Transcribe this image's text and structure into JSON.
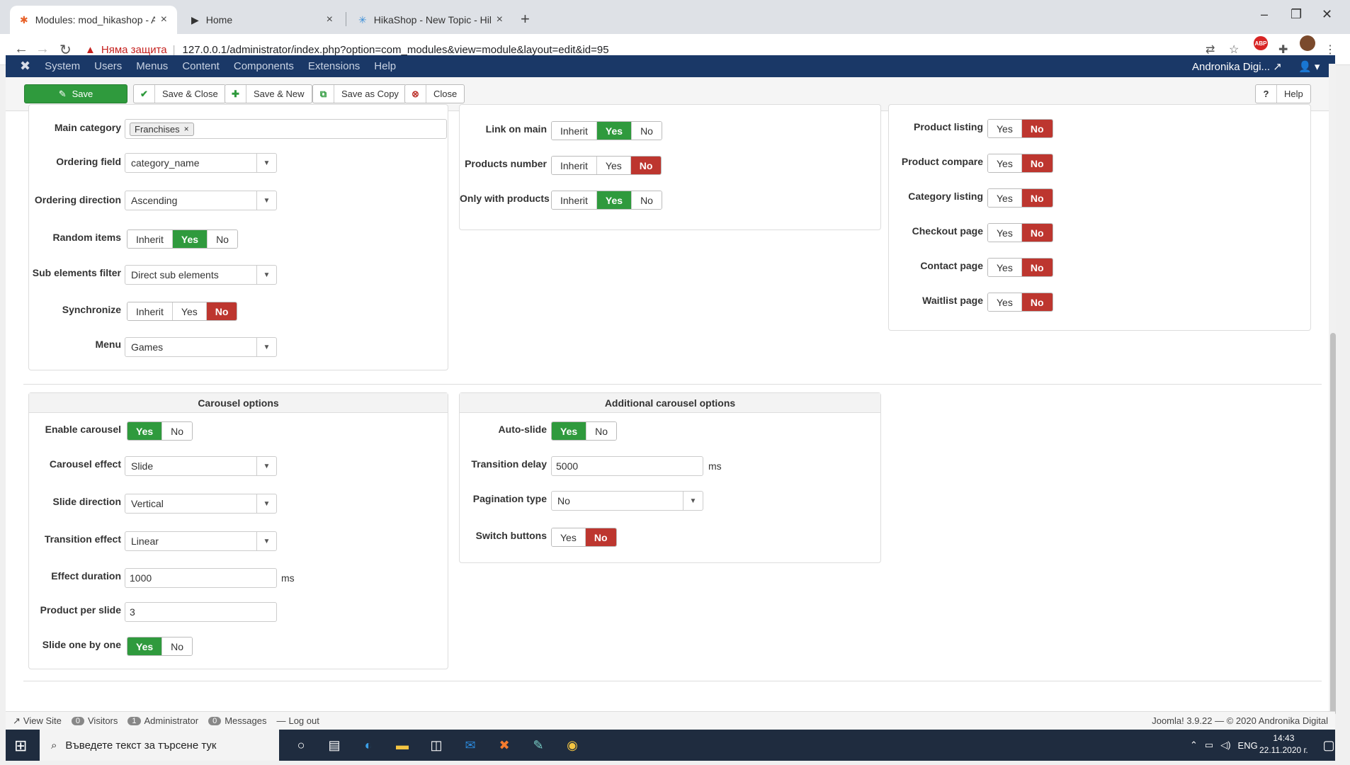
{
  "browser": {
    "tabs": [
      {
        "title": "Modules: mod_hikashop - Andro",
        "active": true
      },
      {
        "title": "Home",
        "active": false
      },
      {
        "title": "HikaShop - New Topic - HikaSho",
        "active": false
      }
    ],
    "security_label": "Няма защита",
    "url": "127.0.0.1/administrator/index.php?option=com_modules&view=module&layout=edit&id=95"
  },
  "joomla_nav": {
    "menu": [
      "System",
      "Users",
      "Menus",
      "Content",
      "Components",
      "Extensions",
      "Help"
    ],
    "site_name": "Andronika Digi..."
  },
  "toolbar": {
    "save": "Save",
    "save_close": "Save & Close",
    "save_new": "Save & New",
    "save_copy": "Save as Copy",
    "close": "Close",
    "help": "Help"
  },
  "left_panel": {
    "main_category_label": "Main category",
    "main_category_chip": "Franchises",
    "ordering_field_label": "Ordering field",
    "ordering_field_value": "category_name",
    "ordering_direction_label": "Ordering direction",
    "ordering_direction_value": "Ascending",
    "random_items_label": "Random items",
    "sub_elements_filter_label": "Sub elements filter",
    "sub_elements_filter_value": "Direct sub elements",
    "synchronize_label": "Synchronize",
    "menu_label": "Menu",
    "menu_value": "Games"
  },
  "middle_panel": {
    "link_on_main_label": "Link on main",
    "products_number_label": "Products number",
    "only_with_products_label": "Only with products"
  },
  "right_panel": {
    "product_listing_label": "Product listing",
    "product_compare_label": "Product compare",
    "category_listing_label": "Category listing",
    "checkout_page_label": "Checkout page",
    "contact_page_label": "Contact page",
    "waitlist_page_label": "Waitlist page"
  },
  "toggle_text": {
    "inherit": "Inherit",
    "yes": "Yes",
    "no": "No"
  },
  "carousel": {
    "title": "Carousel options",
    "enable_carousel_label": "Enable carousel",
    "carousel_effect_label": "Carousel effect",
    "carousel_effect_value": "Slide",
    "slide_direction_label": "Slide direction",
    "slide_direction_value": "Vertical",
    "transition_effect_label": "Transition effect",
    "transition_effect_value": "Linear",
    "effect_duration_label": "Effect duration",
    "effect_duration_value": "1000",
    "product_per_slide_label": "Product per slide",
    "product_per_slide_value": "3",
    "slide_one_by_one_label": "Slide one by one",
    "ms": "ms"
  },
  "additional_carousel": {
    "title": "Additional carousel options",
    "auto_slide_label": "Auto-slide",
    "transition_delay_label": "Transition delay",
    "transition_delay_value": "5000",
    "pagination_type_label": "Pagination type",
    "pagination_type_value": "No",
    "switch_buttons_label": "Switch buttons",
    "ms": "ms"
  },
  "statusbar": {
    "view_site": "View Site",
    "visitors_count": "0",
    "visitors": "Visitors",
    "admin_count": "1",
    "administrator": "Administrator",
    "messages_count": "0",
    "messages": "Messages",
    "logout": "Log out",
    "copyright": "Joomla! 3.9.22 — © 2020 Andronika Digital"
  },
  "taskbar": {
    "search_placeholder": "Въведете текст за търсене тук",
    "lang": "ENG",
    "time": "14:43",
    "date": "22.11.2020 г."
  },
  "colors": {
    "save_green": "#2f9a3d",
    "no_red": "#bd362f",
    "joomla_nav": "#1a3867",
    "taskbar": "#1f2c3f"
  }
}
